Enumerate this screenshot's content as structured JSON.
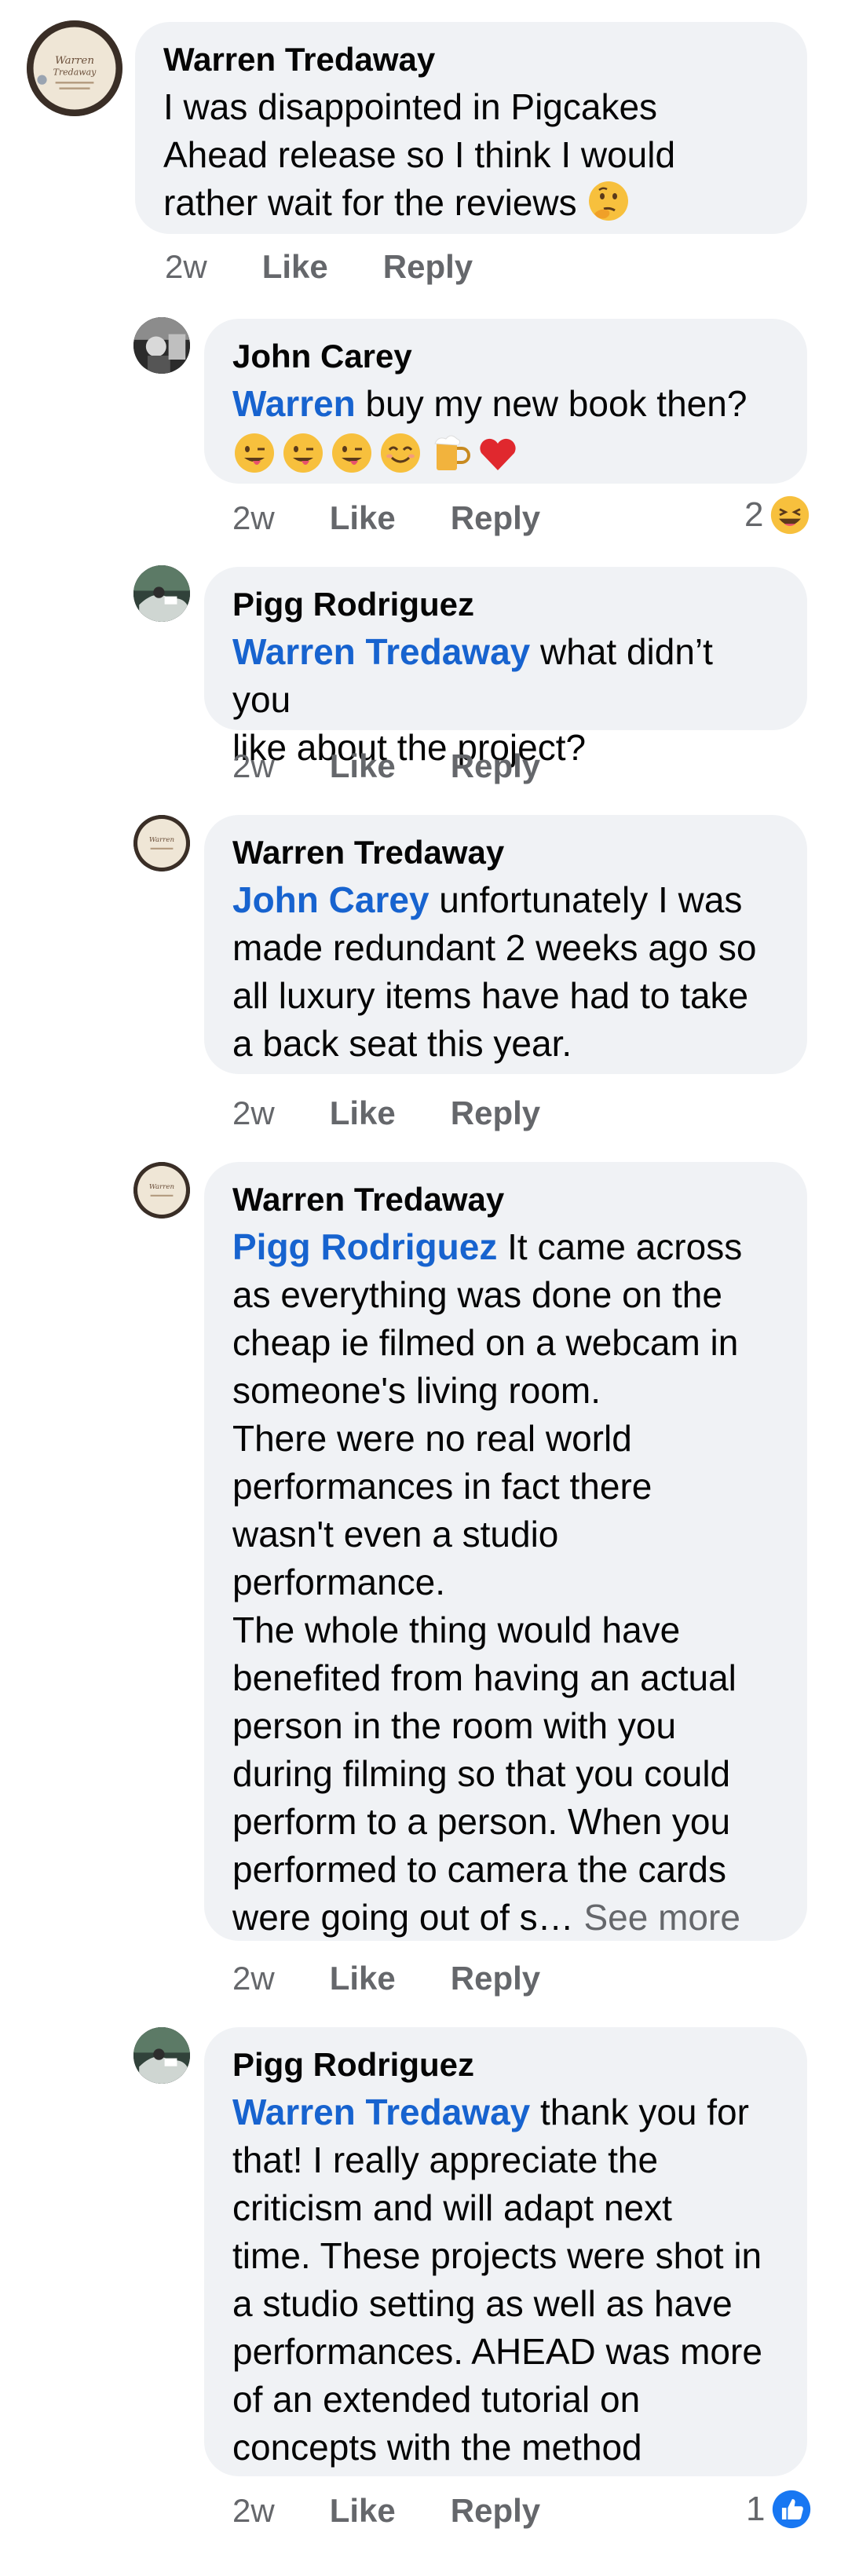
{
  "comments": [
    {
      "author": "Warren Tredaway",
      "text": "I was disappointed in Pigcakes\nAhead release so I think I would\nrather wait for the reviews ",
      "time": "2w",
      "like": "Like",
      "reply": "Reply",
      "avatar": "warren-logo"
    },
    {
      "author": "John Carey",
      "mention": "Warren",
      "text": " buy my new book then?",
      "emojis": [
        "winking-tongue",
        "winking-tongue",
        "winking-tongue",
        "smiling-eyes",
        "beer-mug",
        "red-heart"
      ],
      "time": "2w",
      "like": "Like",
      "reply": "Reply",
      "reaction_count": "2",
      "reaction": "laughing",
      "avatar": "john-photo"
    },
    {
      "author": "Pigg Rodriguez",
      "mention": "Warren Tredaway",
      "text": " what didn’t you\nlike about the project?",
      "time": "2w",
      "like": "Like",
      "reply": "Reply",
      "avatar": "pigg-photo"
    },
    {
      "author": "Warren Tredaway",
      "mention": "John Carey",
      "text": " unfortunately I was\nmade redundant 2 weeks ago so\nall luxury items have had to take\na back seat this year.",
      "time": "2w",
      "like": "Like",
      "reply": "Reply",
      "avatar": "warren-logo"
    },
    {
      "author": "Warren Tredaway",
      "mention": "Pigg Rodriguez",
      "text": " It came across\nas everything was done on the\ncheap ie filmed on a webcam in\nsomeone's living room.\nThere were no real world\nperformances in fact there\nwasn't even a studio\nperformance.\nThe whole thing would have\nbenefited from having an actual\nperson in the room with you\nduring filming so that you could\nperform to a person. When you\nperformed to camera the cards\nwere going out of s… ",
      "see_more": "See more",
      "time": "2w",
      "like": "Like",
      "reply": "Reply",
      "avatar": "warren-logo"
    },
    {
      "author": "Pigg Rodriguez",
      "mention": "Warren Tredaway",
      "text": " thank you for\nthat! I really appreciate the\ncriticism and will adapt next\ntime. These projects were shot in\na studio setting as well as have\nperformances. AHEAD was more\nof an extended tutorial on\nconcepts with the method",
      "time": "2w",
      "like": "Like",
      "reply": "Reply",
      "reaction_count": "1",
      "reaction": "thumbs-up",
      "avatar": "pigg-photo"
    }
  ],
  "colors": {
    "bubble": "#f0f2f5",
    "mention": "#1763cf",
    "meta": "#65676b",
    "like_blue": "#1877f2"
  }
}
